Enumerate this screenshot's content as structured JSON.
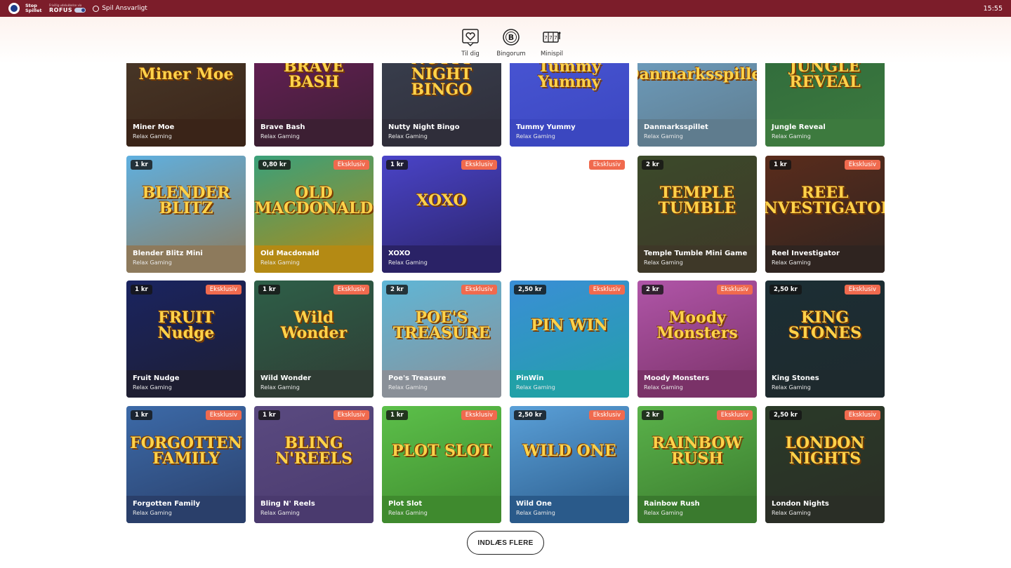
{
  "topbar": {
    "stop_logo": "Stop Spillet",
    "rofus_small": "Frivillig udelukkelse via",
    "rofus_name": "ROFUS",
    "responsible": "Spil Ansvarligt",
    "clock": "15:55"
  },
  "nav": [
    {
      "label": "Til dig",
      "icon": "heart-icon"
    },
    {
      "label": "Bingorum",
      "icon": "bingo-ball-icon",
      "glyph": "B"
    },
    {
      "label": "Minispil",
      "icon": "slot-machine-icon"
    }
  ],
  "load_more": "INDLÆS FLERE",
  "tiles": [
    {
      "title": "Miner Moe",
      "provider": "Relax Gaming",
      "art": "Miner Moe",
      "price": "",
      "exclusive": "",
      "bg": "#4a3a2a",
      "footer": "#3a2418"
    },
    {
      "title": "Brave Bash",
      "provider": "Relax Gaming",
      "art": "BRAVE BASH",
      "price": "",
      "exclusive": "",
      "bg": "#6b1f5a",
      "footer": "#3c1f33"
    },
    {
      "title": "Nutty Night Bingo",
      "provider": "Relax Gaming",
      "art": "NUTTY NIGHT BINGO",
      "price": "",
      "exclusive": "",
      "bg": "#3a4150",
      "footer": "#2f2e3a"
    },
    {
      "title": "Tummy Yummy",
      "provider": "Relax Gaming",
      "art": "Tummy Yummy",
      "price": "",
      "exclusive": "",
      "bg": "#4a57d6",
      "footer": "#3b47c0"
    },
    {
      "title": "Danmarksspillet",
      "provider": "Relax Gaming",
      "art": "Danmarksspillet",
      "price": "",
      "exclusive": "",
      "bg": "#6fa1c4",
      "footer": "#5f7c8e"
    },
    {
      "title": "Jungle Reveal",
      "provider": "Relax Gaming",
      "art": "JUNGLE REVEAL",
      "price": "",
      "exclusive": "",
      "bg": "#2f6a3c",
      "footer": "#3d7a3e"
    },
    {
      "title": "Blender Blitz Mini",
      "provider": "Relax Gaming",
      "art": "BLENDER BLITZ",
      "price": "1 kr",
      "exclusive": "",
      "bg": "#5fb0e0",
      "footer": "#8d7a5c"
    },
    {
      "title": "Old Macdonald",
      "provider": "Relax Gaming",
      "art": "OLD MACDONALD",
      "price": "0,80 kr",
      "exclusive": "Eksklusiv",
      "bg": "#3aa07a",
      "footer": "#b48a14"
    },
    {
      "title": "XOXO",
      "provider": "Relax Gaming",
      "art": "XOXO",
      "price": "1 kr",
      "exclusive": "Eksklusiv",
      "bg": "#4a44c8",
      "footer": "#2a2266"
    },
    {
      "title": "",
      "provider": "",
      "art": "",
      "price": "",
      "exclusive": "Eksklusiv",
      "bg": "#ffffff",
      "footer": "#ffffff"
    },
    {
      "title": "Temple Tumble Mini Game",
      "provider": "Relax Gaming",
      "art": "TEMPLE TUMBLE",
      "price": "2 kr",
      "exclusive": "",
      "bg": "#3c4a2a",
      "footer": "#3e3828"
    },
    {
      "title": "Reel Investigator",
      "provider": "Relax Gaming",
      "art": "REEL INVESTIGATOR",
      "price": "1 kr",
      "exclusive": "Eksklusiv",
      "bg": "#5a2c1c",
      "footer": "#2f2420"
    },
    {
      "title": "Fruit Nudge",
      "provider": "Relax Gaming",
      "art": "FRUIT Nudge",
      "price": "1 kr",
      "exclusive": "Eksklusiv",
      "bg": "#1a2460",
      "footer": "#1e1e32"
    },
    {
      "title": "Wild Wonder",
      "provider": "Relax Gaming",
      "art": "Wild Wonder",
      "price": "1 kr",
      "exclusive": "Eksklusiv",
      "bg": "#2e5f48",
      "footer": "#2f3c34"
    },
    {
      "title": "Poe's Treasure",
      "provider": "Relax Gaming",
      "art": "POE'S TREASURE",
      "price": "2 kr",
      "exclusive": "Eksklusiv",
      "bg": "#5fb6d6",
      "footer": "#8a9098"
    },
    {
      "title": "PinWin",
      "provider": "Relax Gaming",
      "art": "PIN WIN",
      "price": "2,50 kr",
      "exclusive": "Eksklusiv",
      "bg": "#3a8ed6",
      "footer": "#22a0a8"
    },
    {
      "title": "Moody Monsters",
      "provider": "Relax Gaming",
      "art": "Moody Monsters",
      "price": "2 kr",
      "exclusive": "Eksklusiv",
      "bg": "#b055a8",
      "footer": "#7a3268"
    },
    {
      "title": "King Stones",
      "provider": "Relax Gaming",
      "art": "KING STONES",
      "price": "2,50 kr",
      "exclusive": "Eksklusiv",
      "bg": "#1c2e34",
      "footer": "#1e2a2e"
    },
    {
      "title": "Forgotten Family",
      "provider": "Relax Gaming",
      "art": "FORGOTTEN FAMILY",
      "price": "1 kr",
      "exclusive": "Eksklusiv",
      "bg": "#3c6aa8",
      "footer": "#2a3f6a"
    },
    {
      "title": "Bling N' Reels",
      "provider": "Relax Gaming",
      "art": "BLING N'REELS",
      "price": "1 kr",
      "exclusive": "Eksklusiv",
      "bg": "#5a4a80",
      "footer": "#4a3a6e"
    },
    {
      "title": "Plot Slot",
      "provider": "Relax Gaming",
      "art": "PLOT SLOT",
      "price": "1 kr",
      "exclusive": "Eksklusiv",
      "bg": "#5cc04a",
      "footer": "#3f8a2e"
    },
    {
      "title": "Wild One",
      "provider": "Relax Gaming",
      "art": "WILD ONE",
      "price": "2,50 kr",
      "exclusive": "Eksklusiv",
      "bg": "#5aa0d8",
      "footer": "#2a5a8a"
    },
    {
      "title": "Rainbow Rush",
      "provider": "Relax Gaming",
      "art": "RAINBOW RUSH",
      "price": "2 kr",
      "exclusive": "Eksklusiv",
      "bg": "#5ab24a",
      "footer": "#3a7a2e"
    },
    {
      "title": "London Nights",
      "provider": "Relax Gaming",
      "art": "LONDON NIGHTS",
      "price": "2,50 kr",
      "exclusive": "Eksklusiv",
      "bg": "#2a3a28",
      "footer": "#2a2e26"
    }
  ]
}
